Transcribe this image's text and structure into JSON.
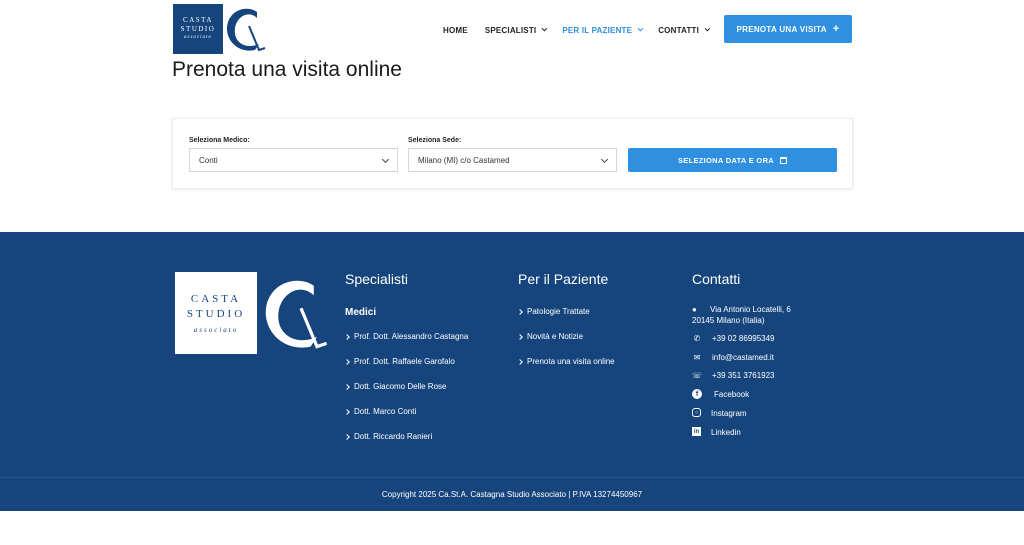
{
  "header": {
    "logo": {
      "line1": "CASTA",
      "line2": "STUDIO",
      "line3": "associato",
      "mark": "C"
    },
    "nav": [
      {
        "label": "HOME",
        "has_dropdown": false,
        "active": false
      },
      {
        "label": "SPECIALISTI",
        "has_dropdown": true,
        "active": false
      },
      {
        "label": "PER IL PAZIENTE",
        "has_dropdown": true,
        "active": true
      },
      {
        "label": "CONTATTI",
        "has_dropdown": true,
        "active": false
      }
    ],
    "cta_label": "PRENOTA UNA VISITA",
    "cta_icon": "plus-icon"
  },
  "page": {
    "title": "Prenota una visita online"
  },
  "booking": {
    "medico_label": "Seleziona Medico:",
    "medico_value": "Conti",
    "sede_label": "Seleziona Sede:",
    "sede_value": "Milano (MI) c/o Castamed",
    "date_button": "SELEZIONA DATA E ORA",
    "date_icon": "calendar-icon"
  },
  "footer": {
    "logo": {
      "line1": "CASTA",
      "line2": "STUDIO",
      "line3": "associato",
      "mark": "C"
    },
    "specialisti": {
      "title": "Specialisti",
      "subtitle": "Medici",
      "links": [
        "Prof. Dott. Alessandro Castagna",
        "Prof. Dott. Raffaele Garofalo",
        "Dott. Giacomo Delle Rose",
        "Dott. Marco Conti",
        "Dott. Riccardo Ranieri"
      ]
    },
    "paziente": {
      "title": "Per il Paziente",
      "links": [
        "Patologie Trattate",
        "Novità e Notizie",
        "Prenota una visita online"
      ]
    },
    "contatti": {
      "title": "Contatti",
      "address_line1": "Via Antonio Locatelli, 6",
      "address_line2": "20145 Milano (Italia)",
      "phone": "+39 02 86995349",
      "email": "info@castamed.it",
      "whatsapp": "+39 351 3761923",
      "facebook": "Facebook",
      "instagram": "Instagram",
      "linkedin": "Linkedin"
    },
    "copyright": "Copyright 2025 Ca.St.A. Castagna Studio Associato | P.IVA 13274450967"
  },
  "colors": {
    "brand_blue": "#16457e",
    "accent_blue": "#2f8fe0"
  }
}
